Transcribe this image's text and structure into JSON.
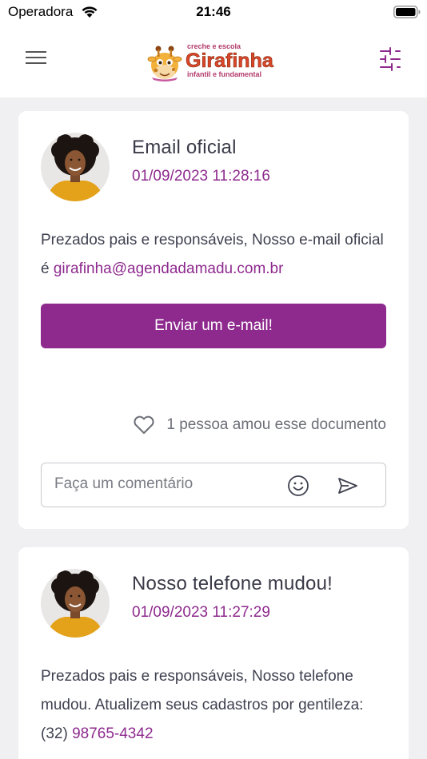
{
  "status_bar": {
    "carrier": "Operadora",
    "time": "21:46"
  },
  "header": {
    "logo": {
      "line1": "creche e escola",
      "name": "Girafinha",
      "line2": "infantil e fundamental"
    },
    "icons": [
      "hamburger-menu-icon",
      "filter-sliders-icon"
    ]
  },
  "colors": {
    "accent": "#8e2a8e",
    "background": "#f0f0f2",
    "card": "#ffffff",
    "text": "#3f4150"
  },
  "posts": [
    {
      "title": "Email oficial",
      "date": "01/09/2023 11:28:16",
      "body_text": "Prezados pais e responsáveis, Nosso e-mail oficial é ",
      "body_link": "girafinha@agendadamadu.com.br",
      "button_label": "Enviar um e-mail!",
      "likes_text": "1 pessoa amou esse documento",
      "comment_placeholder": "Faça um comentário"
    },
    {
      "title": "Nosso telefone mudou!",
      "date": "01/09/2023 11:27:29",
      "body_text": "Prezados pais e responsáveis, Nosso telefone mudou. Atualizem seus cadastros por gentileza: (32) ",
      "body_link": "98765-4342"
    }
  ]
}
